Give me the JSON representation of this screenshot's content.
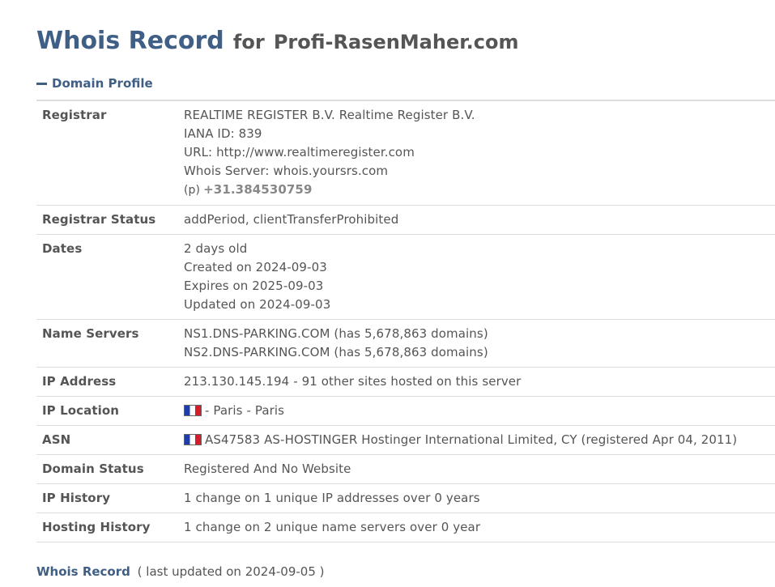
{
  "header": {
    "title_main": "Whois Record",
    "title_for": "for",
    "title_domain": "Profi-RasenMaher.com"
  },
  "section": {
    "toggle_label": "Domain Profile"
  },
  "profile": {
    "registrar": {
      "label": "Registrar",
      "name": "REALTIME REGISTER B.V. Realtime Register B.V.",
      "iana": "IANA ID: 839",
      "url": "URL: http://www.realtimeregister.com",
      "whois_server": "Whois Server: whois.yoursrs.com",
      "phone_prefix": "(p)",
      "phone": "+31.384530759"
    },
    "registrar_status": {
      "label": "Registrar Status",
      "value": "addPeriod, clientTransferProhibited"
    },
    "dates": {
      "label": "Dates",
      "age": "2 days old",
      "created": "Created on 2024-09-03",
      "expires": "Expires on 2025-09-03",
      "updated": "Updated on 2024-09-03"
    },
    "name_servers": {
      "label": "Name Servers",
      "ns1": "NS1.DNS-PARKING.COM (has 5,678,863 domains)",
      "ns2": "NS2.DNS-PARKING.COM (has 5,678,863 domains)"
    },
    "ip_address": {
      "label": "IP Address",
      "value": "213.130.145.194 - 91 other sites hosted on this server"
    },
    "ip_location": {
      "label": "IP Location",
      "flag_icon": "france-flag-icon",
      "value": "- Paris - Paris"
    },
    "asn": {
      "label": "ASN",
      "flag_icon": "france-flag-icon",
      "value": "AS47583 AS-HOSTINGER Hostinger International Limited, CY (registered Apr 04, 2011)"
    },
    "domain_status": {
      "label": "Domain Status",
      "value": "Registered And No Website"
    },
    "ip_history": {
      "label": "IP History",
      "value": "1 change on 1 unique IP addresses over 0 years"
    },
    "hosting_history": {
      "label": "Hosting History",
      "value": "1 change on 2 unique name servers over 0 year"
    }
  },
  "footer": {
    "link": "Whois Record",
    "note": "( last updated on 2024-09-05 )"
  },
  "colors": {
    "accent": "#3f5f86",
    "text": "#555555",
    "border": "#dddddd"
  }
}
